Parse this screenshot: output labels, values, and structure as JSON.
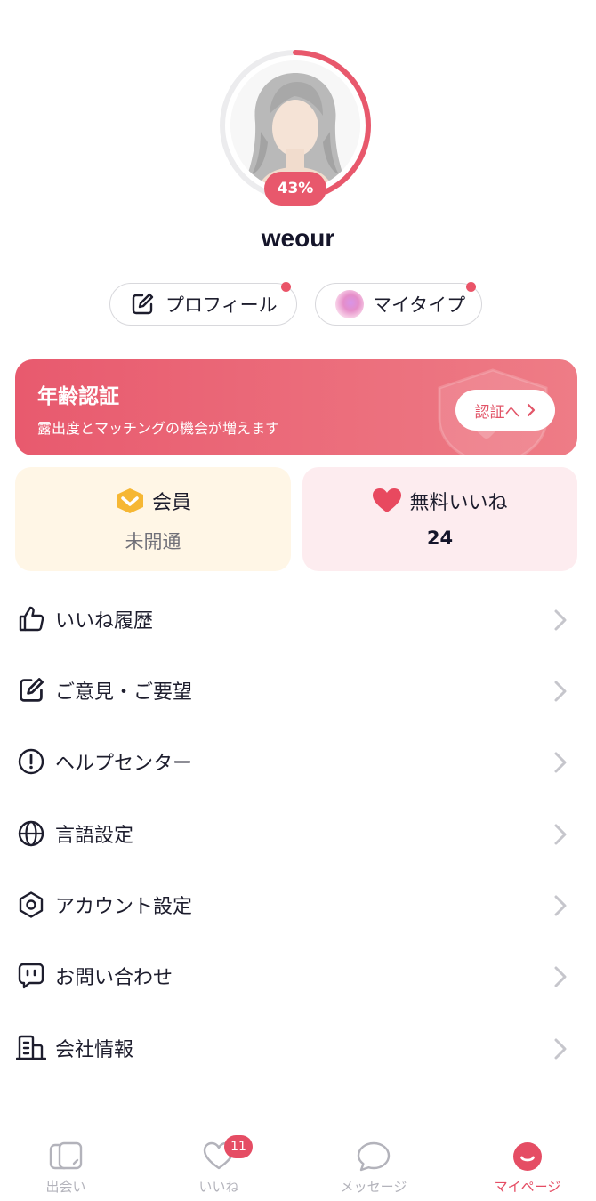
{
  "profile": {
    "completion": "43%",
    "completion_fraction": 0.43,
    "username": "weour"
  },
  "actions": {
    "profile_label": "プロフィール",
    "mytype_label": "マイタイプ"
  },
  "age_verification": {
    "title": "年齢認証",
    "subtitle": "露出度とマッチングの機会が増えます",
    "button_label": "認証へ"
  },
  "membership": {
    "label": "会員",
    "status": "未開通"
  },
  "free_likes": {
    "label": "無料いいね",
    "count": "24"
  },
  "menu": {
    "items": [
      {
        "label": "いいね履歴",
        "icon": "thumbs-up-icon"
      },
      {
        "label": "ご意見・ご要望",
        "icon": "edit-icon"
      },
      {
        "label": "ヘルプセンター",
        "icon": "exclamation-circle-icon"
      },
      {
        "label": "言語設定",
        "icon": "globe-icon"
      },
      {
        "label": "アカウント設定",
        "icon": "settings-hexagon-icon"
      },
      {
        "label": "お問い合わせ",
        "icon": "chat-icon"
      },
      {
        "label": "会社情報",
        "icon": "building-icon"
      }
    ]
  },
  "bottom_nav": {
    "items": [
      {
        "label": "出会い",
        "icon": "cards-icon"
      },
      {
        "label": "いいね",
        "icon": "heart-outline-icon",
        "badge": "11"
      },
      {
        "label": "メッセージ",
        "icon": "speech-bubble-icon"
      },
      {
        "label": "マイページ",
        "icon": "smile-icon",
        "active": true
      }
    ]
  },
  "colors": {
    "accent": "#e8586c",
    "member_card_bg": "#fff6e6",
    "likes_card_bg": "#fdecef",
    "inactive_nav": "#b3b3bb"
  }
}
